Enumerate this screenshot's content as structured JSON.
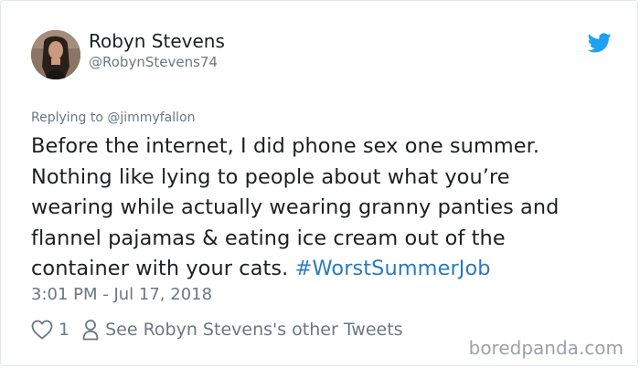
{
  "tweet": {
    "author": {
      "display_name": "Robyn Stevens",
      "handle": "@RobynStevens74"
    },
    "replying_to": {
      "prefix": "Replying to ",
      "mention": "@jimmyfallon"
    },
    "text_lines": [
      "Before the internet, I did phone sex one summer.",
      "Nothing like lying to people about what you’re",
      "wearing while actually wearing granny panties and",
      "flannel pajamas & eating ice cream out of the",
      "container with your cats. "
    ],
    "hashtag": "#WorstSummerJob",
    "timestamp": "3:01 PM - Jul 17, 2018",
    "likes": "1",
    "profile_link": "See Robyn Stevens's other Tweets",
    "icons": {
      "brand": "twitter-bird-icon",
      "like": "heart-icon",
      "profile": "person-icon"
    },
    "colors": {
      "brand_blue": "#1da1f2",
      "link_blue": "#2b7bb9",
      "secondary_text": "#697882"
    }
  },
  "watermark": "boredpanda.com"
}
